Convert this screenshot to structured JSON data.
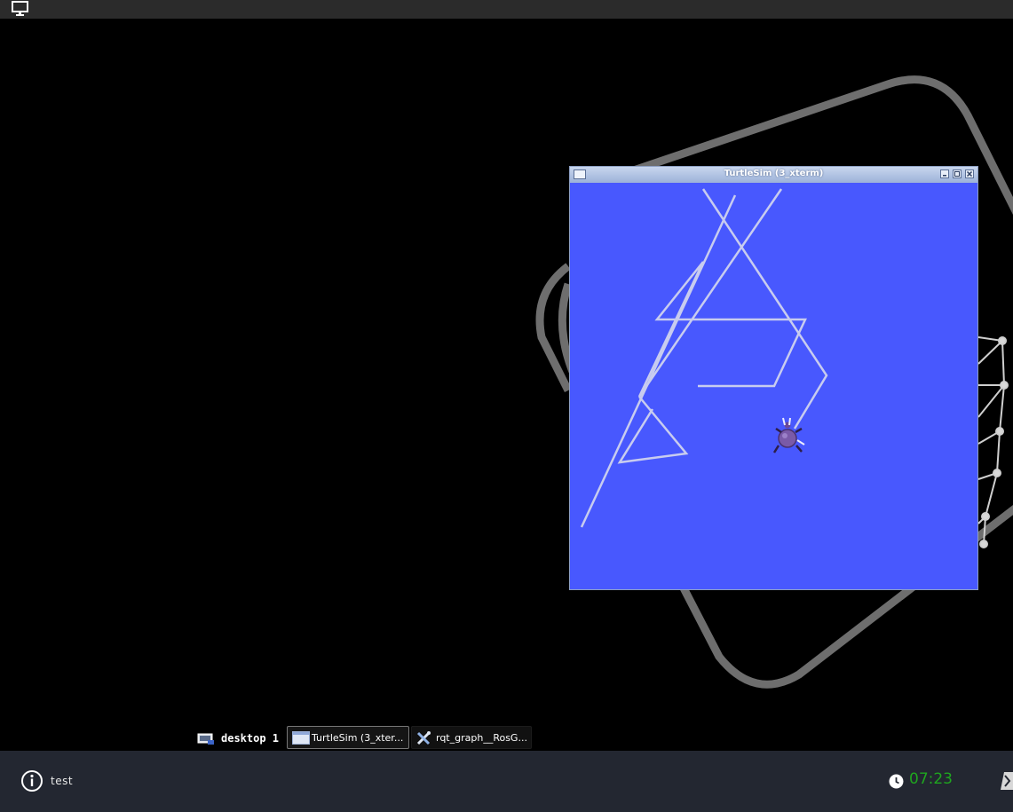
{
  "top_bar": {
    "icon": "monitor-icon"
  },
  "turtlesim_window": {
    "title": "TurtleSim (3_xterm)",
    "background_color": "#4858fe",
    "trail_color": "#c8ccef"
  },
  "taskbar": {
    "desktop_label": "desktop 1",
    "tasks": [
      {
        "label": "TurtleSim (3_xter...",
        "icon": "window-icon"
      },
      {
        "label": "rqt_graph__RosG...",
        "icon": "tools-icon"
      }
    ]
  },
  "bottom_bar": {
    "user_label": "test",
    "clock": "07:23",
    "clock_color": "#1fa51f"
  }
}
